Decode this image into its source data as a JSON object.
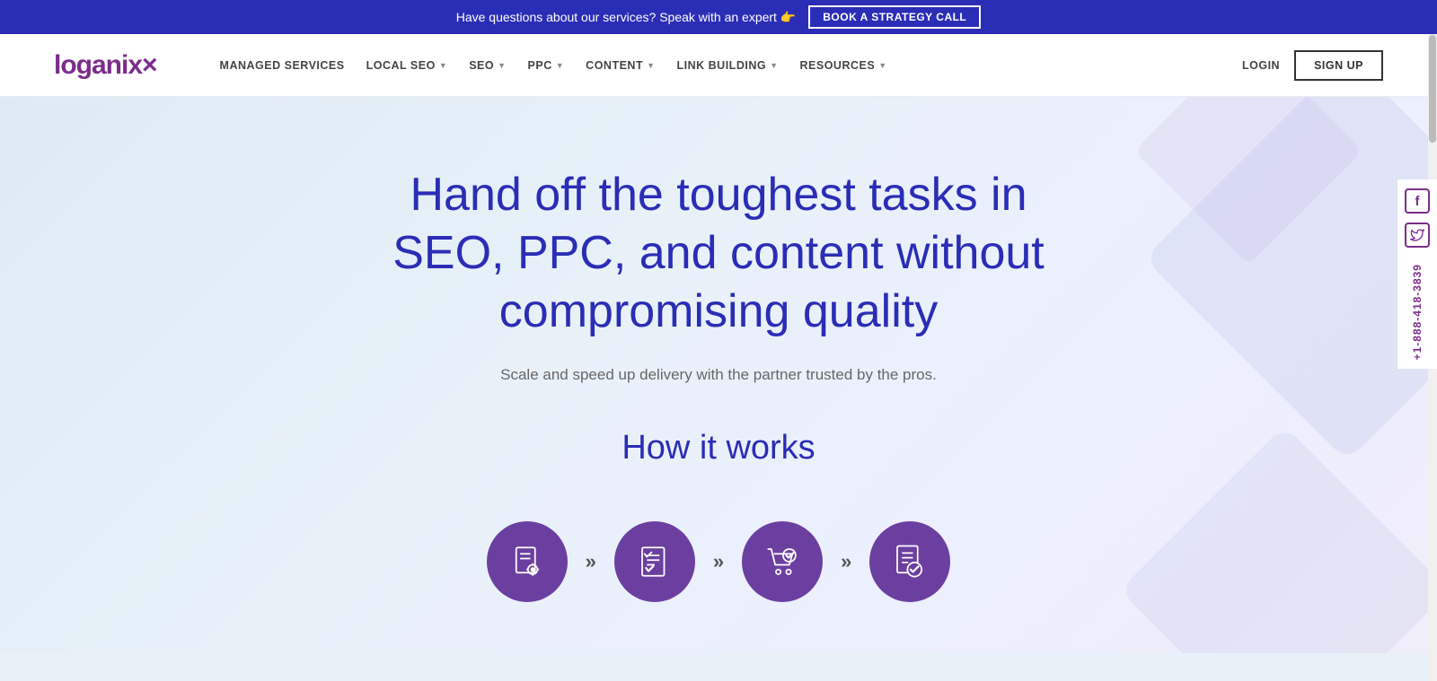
{
  "topbar": {
    "message": "Have questions about our services? Speak with an expert 👉",
    "cta_label": "BOOK A STRATEGY CALL"
  },
  "navbar": {
    "logo_text": "loganix",
    "logo_x": "×",
    "nav_items": [
      {
        "label": "MANAGED SERVICES",
        "has_dropdown": false
      },
      {
        "label": "LOCAL SEO",
        "has_dropdown": true
      },
      {
        "label": "SEO",
        "has_dropdown": true
      },
      {
        "label": "PPC",
        "has_dropdown": true
      },
      {
        "label": "CONTENT",
        "has_dropdown": true
      },
      {
        "label": "LINK BUILDING",
        "has_dropdown": true
      },
      {
        "label": "RESOURCES",
        "has_dropdown": true
      }
    ],
    "login_label": "LOGIN",
    "signup_label": "SIGN UP"
  },
  "hero": {
    "title": "Hand off the toughest tasks in SEO, PPC, and content without compromising quality",
    "subtitle": "Scale and speed up delivery with the partner trusted by the pros.",
    "how_it_works_label": "How it works"
  },
  "steps": [
    {
      "id": "step-1",
      "icon": "document-settings"
    },
    {
      "id": "step-2",
      "icon": "checklist"
    },
    {
      "id": "step-3",
      "icon": "cart-check"
    },
    {
      "id": "step-4",
      "icon": "doc-check"
    }
  ],
  "social": {
    "facebook_label": "f",
    "twitter_label": "🐦",
    "phone": "+1-888-418-3839"
  }
}
